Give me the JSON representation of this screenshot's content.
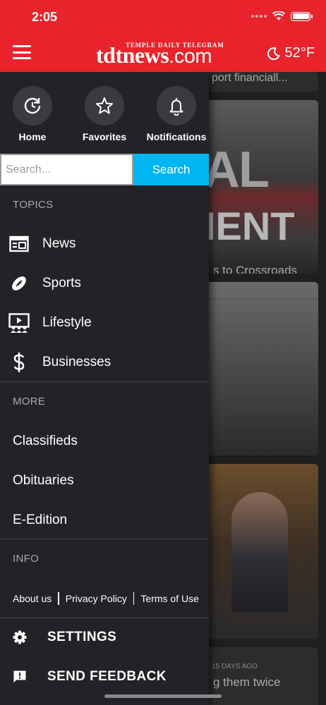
{
  "status_bar": {
    "time": "2:05"
  },
  "header": {
    "logo_tagline": "TEMPLE DAILY TELEGRAM",
    "logo_main": "tdtnews",
    "logo_suffix": ".com",
    "weather_temp": "52°F",
    "weather_icon": "moon-icon"
  },
  "quick_actions": [
    {
      "label": "Home",
      "icon": "home-refresh-icon"
    },
    {
      "label": "Favorites",
      "icon": "star-icon"
    },
    {
      "label": "Notifications",
      "icon": "bell-icon"
    }
  ],
  "search": {
    "placeholder": "Search...",
    "value": "",
    "button_label": "Search"
  },
  "topics": {
    "heading": "TOPICS",
    "items": [
      {
        "label": "News",
        "icon": "newspaper-icon"
      },
      {
        "label": "Sports",
        "icon": "football-icon"
      },
      {
        "label": "Lifestyle",
        "icon": "video-audience-icon"
      },
      {
        "label": "Businesses",
        "icon": "dollar-icon"
      }
    ]
  },
  "more": {
    "heading": "MORE",
    "items": [
      {
        "label": "Classifieds"
      },
      {
        "label": "Obituaries"
      },
      {
        "label": "E-Edition"
      }
    ]
  },
  "info": {
    "heading": "INFO",
    "links": [
      {
        "label": "About us"
      },
      {
        "label": "Privacy Policy"
      },
      {
        "label": "Terms of Use"
      }
    ]
  },
  "bottom_actions": [
    {
      "label": "SETTINGS",
      "icon": "gear-icon"
    },
    {
      "label": "SEND FEEDBACK",
      "icon": "feedback-icon"
    }
  ],
  "background_articles": [
    {
      "title_fragment": "port financiall..."
    },
    {
      "image_text_1": "AL",
      "image_text_2": "IENT",
      "title_fragment": "s to Crossroads"
    },
    {
      "title_fragment": ""
    },
    {
      "title_fragment": ""
    },
    {
      "meta": "15 DAYS AGO",
      "title_fragment": "g them twice"
    }
  ],
  "colors": {
    "header_red": "#e8232b",
    "drawer_bg": "#222327",
    "search_blue": "#00b5f1"
  }
}
